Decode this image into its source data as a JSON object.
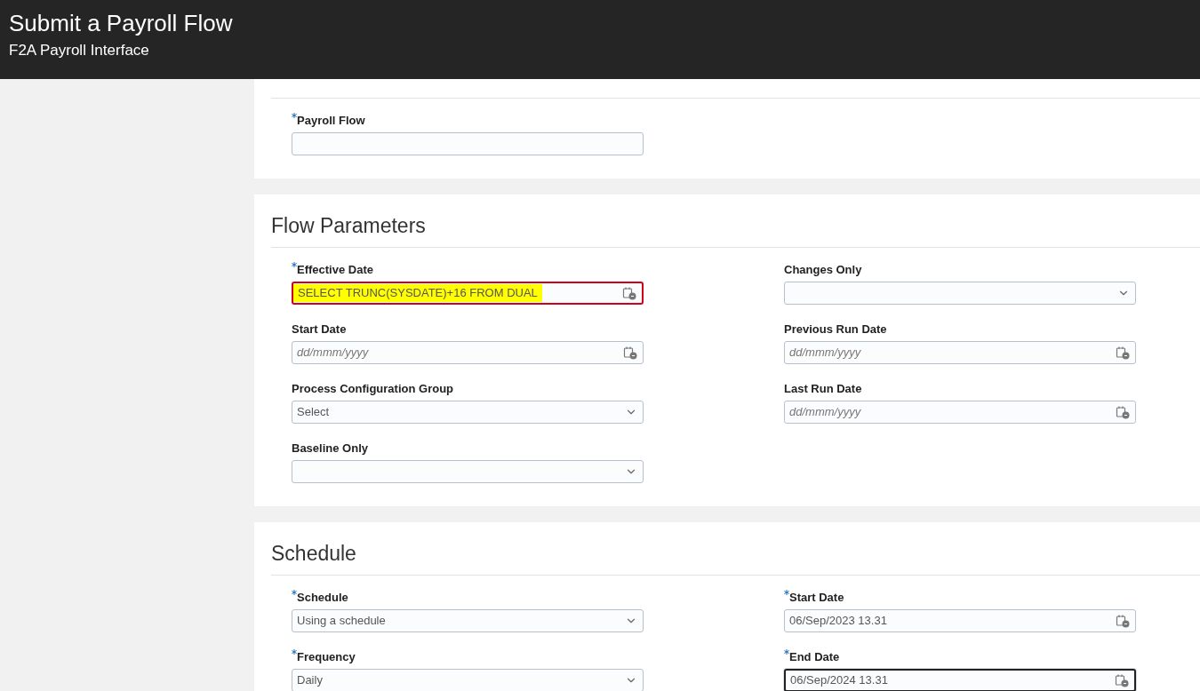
{
  "header": {
    "title": "Submit a Payroll Flow",
    "subtitle": "F2A Payroll Interface"
  },
  "sections": [
    {
      "columns": [
        [
          {
            "kind": "text",
            "label": "Payroll Flow",
            "required": true,
            "error": false,
            "focused": false
          }
        ]
      ]
    },
    {
      "title": "Flow Parameters",
      "columns": [
        [
          {
            "kind": "date",
            "label": "Effective Date",
            "required": true,
            "error": true,
            "focused": false,
            "highlighted": true,
            "value": "SELECT TRUNC(SYSDATE)+16 FROM DUAL"
          },
          {
            "kind": "date",
            "label": "Start Date",
            "required": false,
            "error": false,
            "focused": false,
            "placeholder": "dd/mmm/yyyy"
          },
          {
            "kind": "select",
            "label": "Process Configuration Group",
            "required": false,
            "error": false,
            "focused": false,
            "highlighted": false,
            "value": "Select"
          },
          {
            "kind": "select",
            "label": "Baseline Only",
            "required": false,
            "error": false,
            "focused": false
          }
        ],
        [
          {
            "kind": "select",
            "label": "Changes Only",
            "required": false,
            "error": false,
            "focused": false
          },
          {
            "kind": "date",
            "label": "Previous Run Date",
            "required": false,
            "error": false,
            "focused": false,
            "placeholder": "dd/mmm/yyyy"
          },
          {
            "kind": "date",
            "label": "Last Run Date",
            "required": false,
            "error": false,
            "focused": false,
            "placeholder": "dd/mmm/yyyy"
          }
        ]
      ]
    },
    {
      "title": "Schedule",
      "columns": [
        [
          {
            "kind": "select",
            "label": "Schedule",
            "required": true,
            "error": false,
            "focused": false,
            "highlighted": false,
            "value": "Using a schedule"
          },
          {
            "kind": "select",
            "label": "Frequency",
            "required": true,
            "error": false,
            "focused": false,
            "highlighted": false,
            "value": "Daily"
          }
        ],
        [
          {
            "kind": "date",
            "label": "Start Date",
            "required": true,
            "error": false,
            "focused": false,
            "highlighted": false,
            "value": "06/Sep/2023 13.31"
          },
          {
            "kind": "date",
            "label": "End Date",
            "required": true,
            "error": false,
            "focused": true,
            "highlighted": false,
            "value": "06/Sep/2024 13.31"
          }
        ]
      ]
    }
  ]
}
